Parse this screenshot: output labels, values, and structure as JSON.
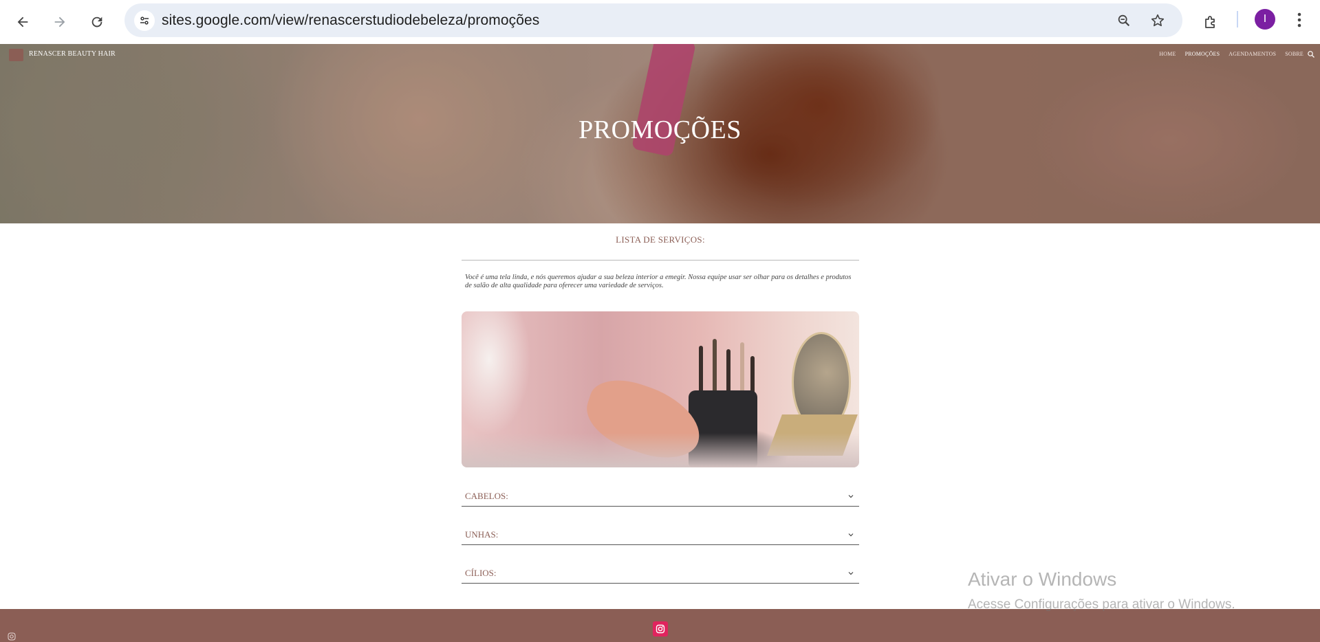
{
  "browser": {
    "url": "sites.google.com/view/renascerstudiodebeleza/promoções",
    "profile_initial": "I",
    "profile_color": "#7b1fa2",
    "icons": [
      "back-icon",
      "forward-icon",
      "reload-icon",
      "tune-icon",
      "zoom-icon",
      "star-icon",
      "extensions-icon",
      "more-icon"
    ]
  },
  "site": {
    "name": "RENASCER BEAUTY HAIR",
    "nav": [
      "HOME",
      "PROMOÇÕES",
      "AGENDAMENTOS",
      "SOBRE"
    ],
    "active_nav": "PROMOÇÕES",
    "brand_color": "#8b5e55"
  },
  "hero": {
    "title": "PROMOÇÕES"
  },
  "content": {
    "section_title": "LISTA DE SERVIÇOS:",
    "intro": "Você é uma tela linda, e nós queremos ajudar a sua beleza interior a emegir. Nossa equipe usar ser olhar para os detalhes e produtos de salão de alta qualidade para oferecer uma variedade de serviços.",
    "accordions": [
      "CABELOS:",
      "UNHAS:",
      "CÍLIOS:"
    ]
  },
  "footer": {
    "social_icon": "instagram-icon",
    "social_color": "#e0245e"
  },
  "watermark": {
    "line1": "Ativar o Windows",
    "line2": "Acesse Configurações para ativar o Windows."
  }
}
